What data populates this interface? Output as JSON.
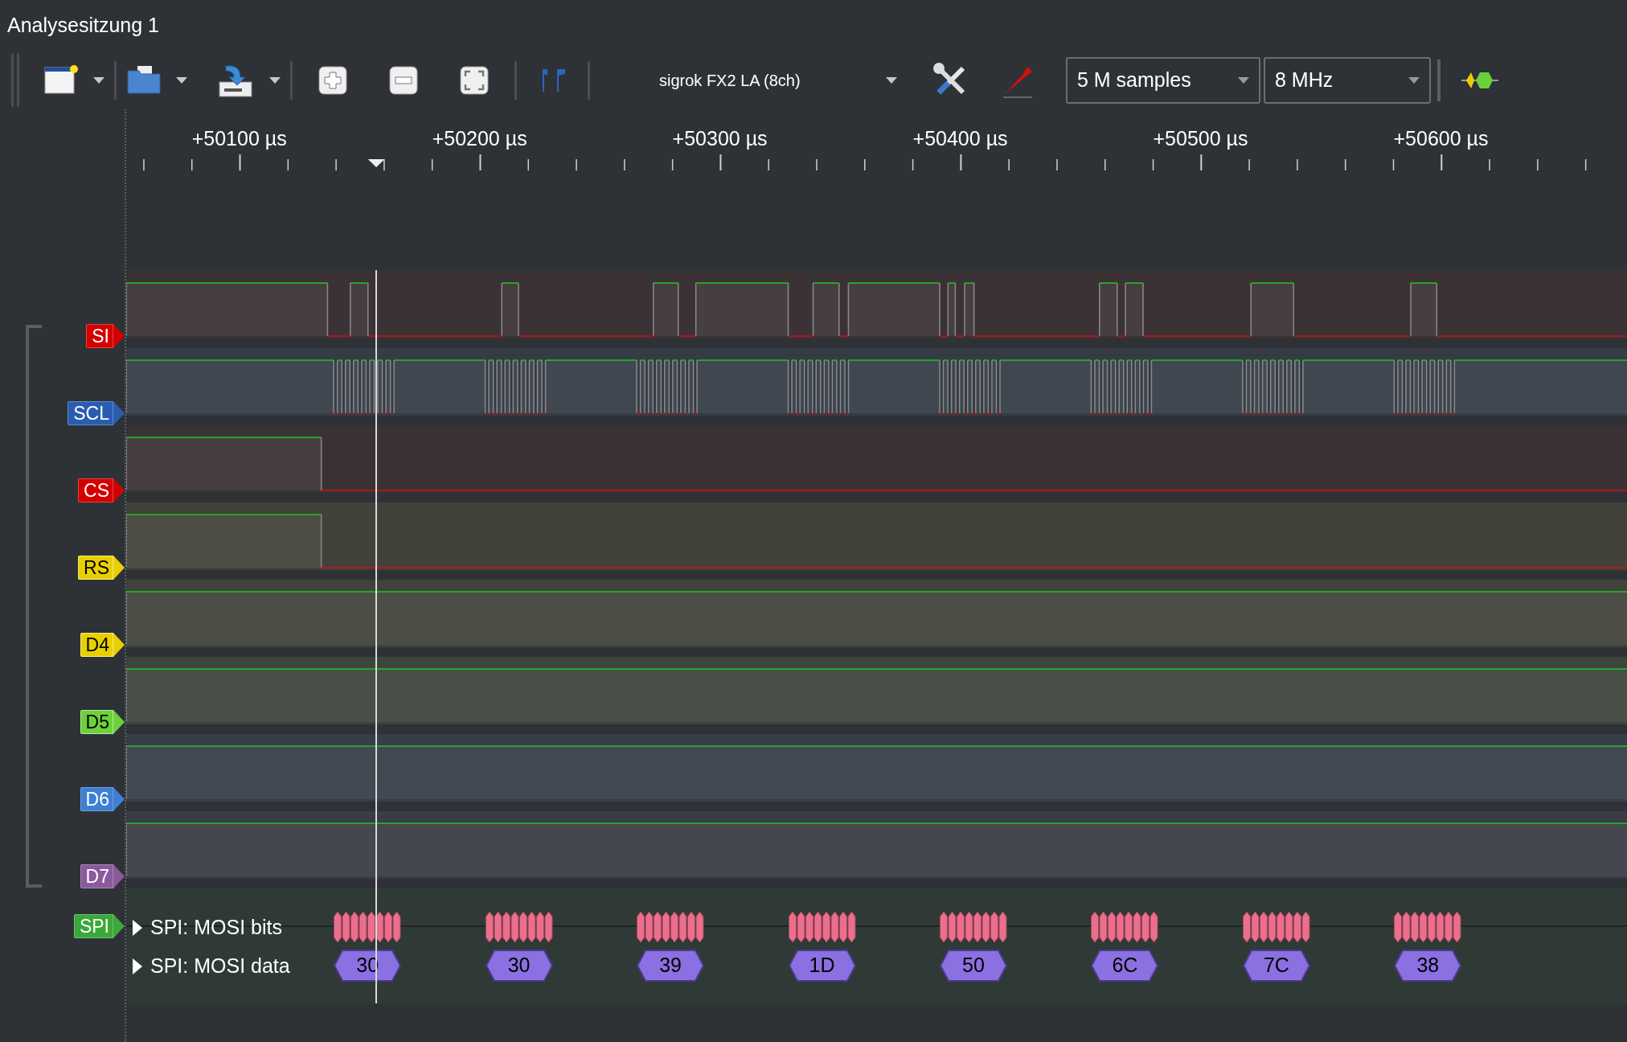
{
  "window": {
    "title": "Analysesitzung 1"
  },
  "toolbar": {
    "device": "sigrok FX2 LA (8ch)",
    "samples": "5 M samples",
    "rate": "8 MHz"
  },
  "ruler": {
    "labels": [
      "+50100 µs",
      "+50200 µs",
      "+50300 µs",
      "+50400 µs",
      "+50500 µs",
      "+50600 µs"
    ]
  },
  "channels": [
    {
      "name": "SI",
      "color": "#d40000"
    },
    {
      "name": "SCL",
      "color": "#2a5db0"
    },
    {
      "name": "CS",
      "color": "#d40000"
    },
    {
      "name": "RS",
      "color": "#e8d000"
    },
    {
      "name": "D4",
      "color": "#e8d000"
    },
    {
      "name": "D5",
      "color": "#6ad13a"
    },
    {
      "name": "D6",
      "color": "#3c7fd5"
    },
    {
      "name": "D7",
      "color": "#8a5a9c"
    }
  ],
  "decoder": {
    "name": "SPI",
    "color": "#3aa83a",
    "rows": [
      {
        "label": "SPI: MOSI bits",
        "expanded": false
      },
      {
        "label": "SPI: MOSI data",
        "expanded": false
      }
    ],
    "data": [
      "30",
      "30",
      "39",
      "1D",
      "50",
      "6C",
      "7C",
      "38"
    ]
  }
}
